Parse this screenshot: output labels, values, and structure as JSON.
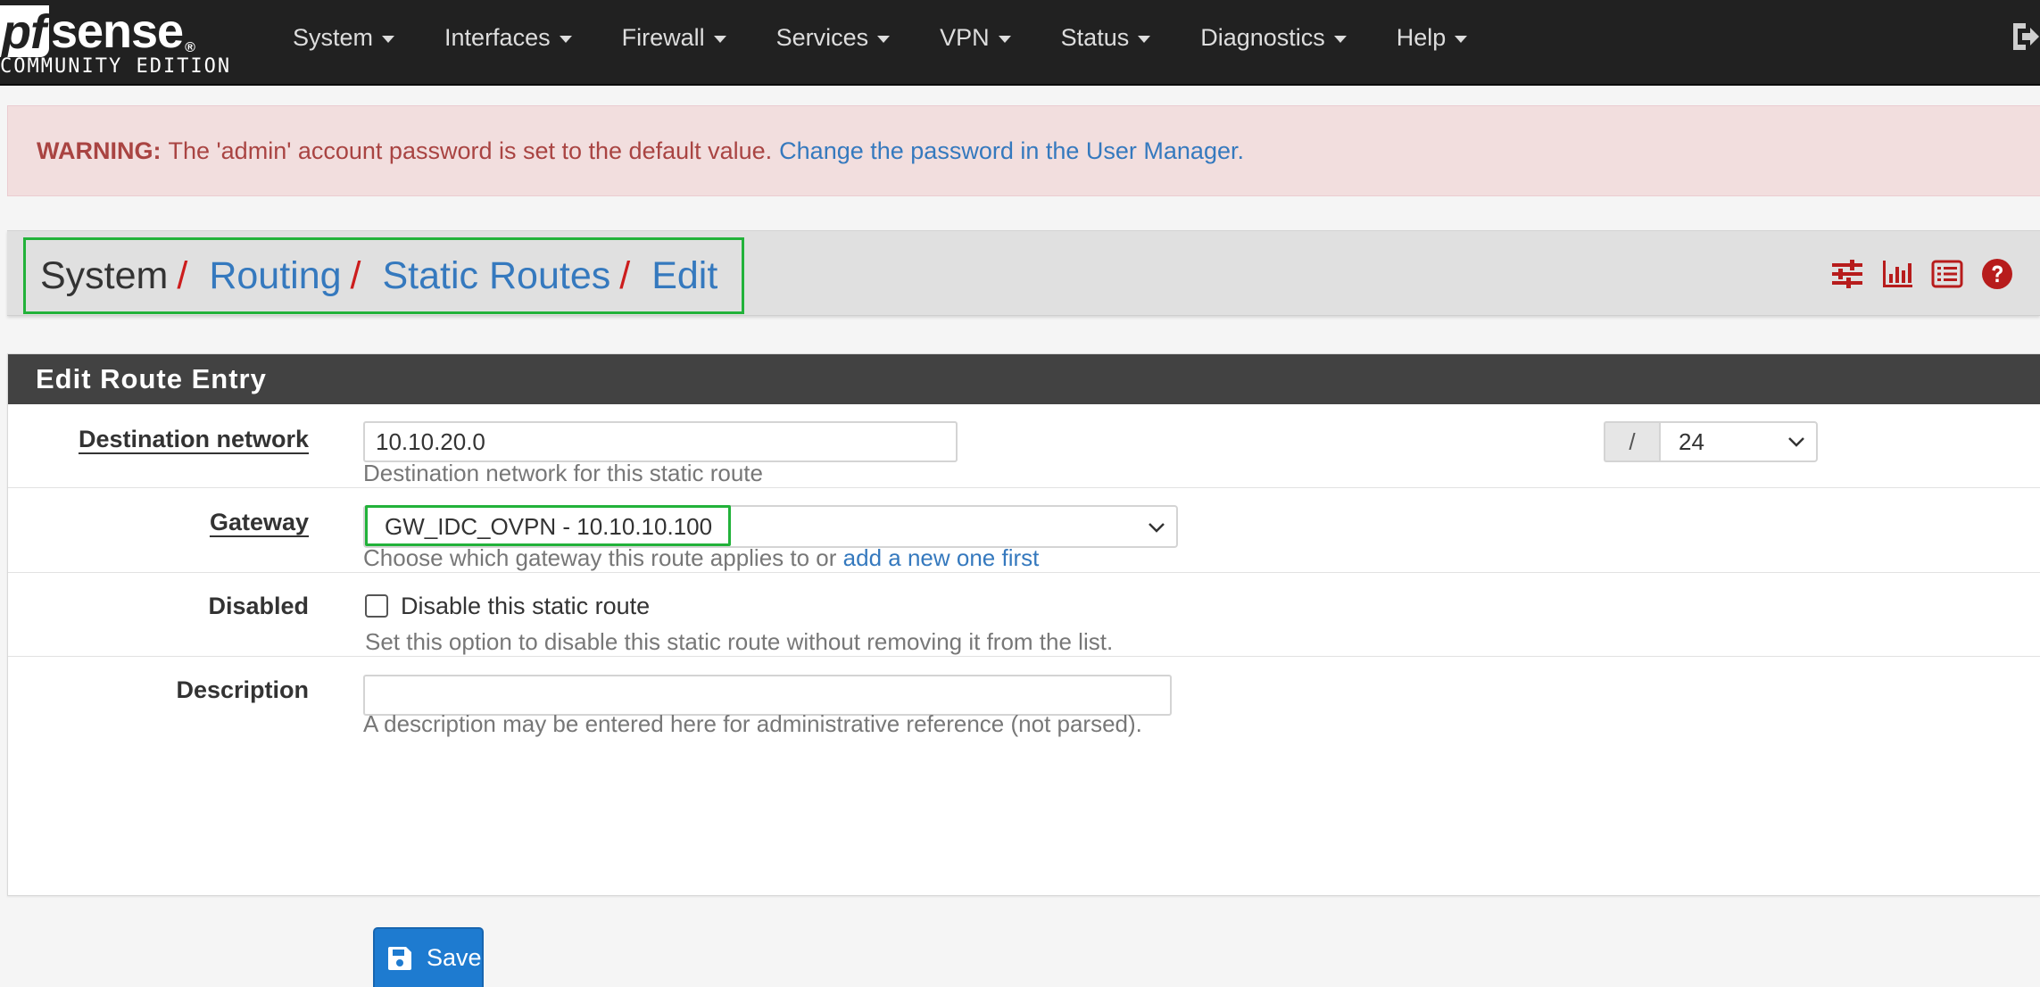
{
  "brand": {
    "logo_pf": "pf",
    "logo_sense": "sense",
    "logo_reg": "®",
    "edition": "COMMUNITY EDITION"
  },
  "nav": {
    "items": [
      {
        "label": "System"
      },
      {
        "label": "Interfaces"
      },
      {
        "label": "Firewall"
      },
      {
        "label": "Services"
      },
      {
        "label": "VPN"
      },
      {
        "label": "Status"
      },
      {
        "label": "Diagnostics"
      },
      {
        "label": "Help"
      }
    ],
    "logout_icon": "logout-icon"
  },
  "alert": {
    "prefix": "WARNING:",
    "message": "The 'admin' account password is set to the default value.",
    "link": "Change the password in the User Manager."
  },
  "breadcrumb": {
    "root": "System",
    "items": [
      "Routing",
      "Static Routes",
      "Edit"
    ],
    "separator": "/"
  },
  "tools": [
    "sliders-icon",
    "bar-chart-icon",
    "list-icon",
    "help-icon"
  ],
  "panel": {
    "title": "Edit Route Entry",
    "destination": {
      "label": "Destination network",
      "value": "10.10.20.0",
      "slash": "/",
      "mask": "24",
      "help": "Destination network for this static route"
    },
    "gateway": {
      "label": "Gateway",
      "selected": "GW_IDC_OVPN - 10.10.10.100",
      "help_text": "Choose which gateway this route applies to or",
      "help_link": "add a new one first"
    },
    "disabled": {
      "label": "Disabled",
      "checkbox_label": "Disable this static route",
      "checked": false,
      "help": "Set this option to disable this static route without removing it from the list."
    },
    "description": {
      "label": "Description",
      "value": "",
      "help": "A description may be entered here for administrative reference (not parsed)."
    }
  },
  "save": {
    "label": "Save"
  },
  "colors": {
    "navbar": "#212121",
    "link": "#3579be",
    "separator": "#cc1d1d",
    "highlight": "#22b23a",
    "primary_button": "#1e7bd0",
    "alert_bg": "#f2dede",
    "alert_text": "#a94442"
  }
}
